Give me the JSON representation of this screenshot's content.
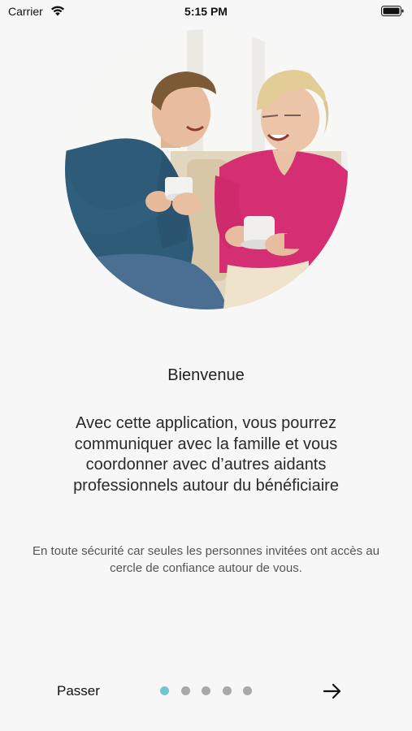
{
  "status_bar": {
    "carrier": "Carrier",
    "time": "5:15 PM",
    "icons": [
      "wifi-icon",
      "battery-icon"
    ]
  },
  "onboarding": {
    "title": "Bienvenue",
    "main_text": "Avec cette application, vous pourrez communiquer avec la famille et vous coordonner avec d’autres aidants professionnels autour du bénéficiaire",
    "secondary_text": "En toute sécurité car seules les personnes invitées ont accès au cercle de confiance autour de vous.",
    "pager": {
      "total": 5,
      "active_index": 0,
      "active_color": "#6bc8cf",
      "inactive_color": "#a8a8a8"
    }
  },
  "footer": {
    "skip_label": "Passer",
    "next_icon": "arrow-right-icon"
  }
}
